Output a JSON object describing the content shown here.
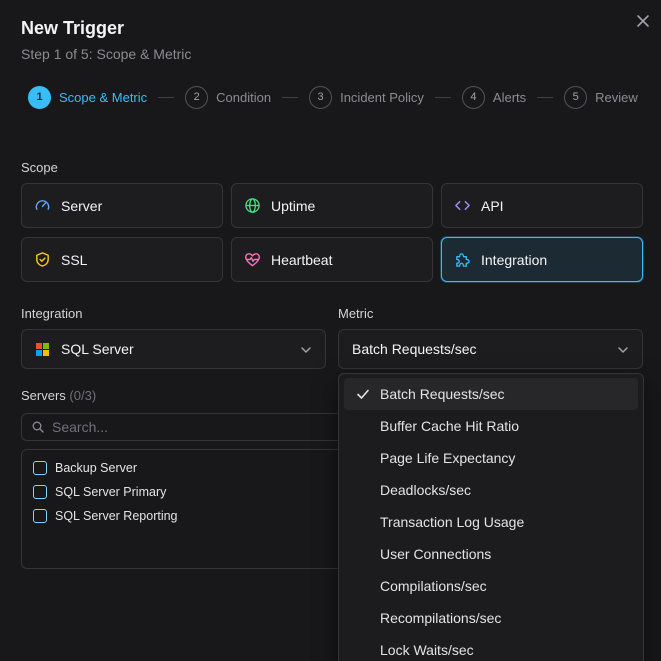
{
  "header": {
    "title": "New Trigger",
    "subtitle": "Step 1 of 5: Scope & Metric"
  },
  "steps": [
    {
      "num": "1",
      "label": "Scope & Metric",
      "active": true
    },
    {
      "num": "2",
      "label": "Condition"
    },
    {
      "num": "3",
      "label": "Incident Policy"
    },
    {
      "num": "4",
      "label": "Alerts"
    },
    {
      "num": "5",
      "label": "Review"
    }
  ],
  "scope": {
    "label": "Scope",
    "options": [
      {
        "label": "Server",
        "icon": "gauge-icon"
      },
      {
        "label": "Uptime",
        "icon": "globe-icon"
      },
      {
        "label": "API",
        "icon": "code-icon"
      },
      {
        "label": "SSL",
        "icon": "shield-icon"
      },
      {
        "label": "Heartbeat",
        "icon": "heart-pulse-icon"
      },
      {
        "label": "Integration",
        "icon": "puzzle-icon",
        "selected": true
      }
    ]
  },
  "integration": {
    "label": "Integration",
    "value": "SQL Server",
    "icon": "microsoft-logo-icon"
  },
  "metric": {
    "label": "Metric",
    "value": "Batch Requests/sec",
    "options": [
      {
        "label": "Batch Requests/sec",
        "selected": true
      },
      {
        "label": "Buffer Cache Hit Ratio"
      },
      {
        "label": "Page Life Expectancy"
      },
      {
        "label": "Deadlocks/sec"
      },
      {
        "label": "Transaction Log Usage"
      },
      {
        "label": "User Connections"
      },
      {
        "label": "Compilations/sec"
      },
      {
        "label": "Recompilations/sec"
      },
      {
        "label": "Lock Waits/sec"
      }
    ]
  },
  "servers": {
    "label": "Servers",
    "count": "(0/3)",
    "search_placeholder": "Search...",
    "items": [
      {
        "name": "Backup Server"
      },
      {
        "name": "SQL Server Primary"
      },
      {
        "name": "SQL Server Reporting"
      }
    ]
  },
  "colors": {
    "accent": "#38bdf8",
    "background": "#18181b",
    "card": "#1d1d20",
    "border": "#34343a"
  }
}
